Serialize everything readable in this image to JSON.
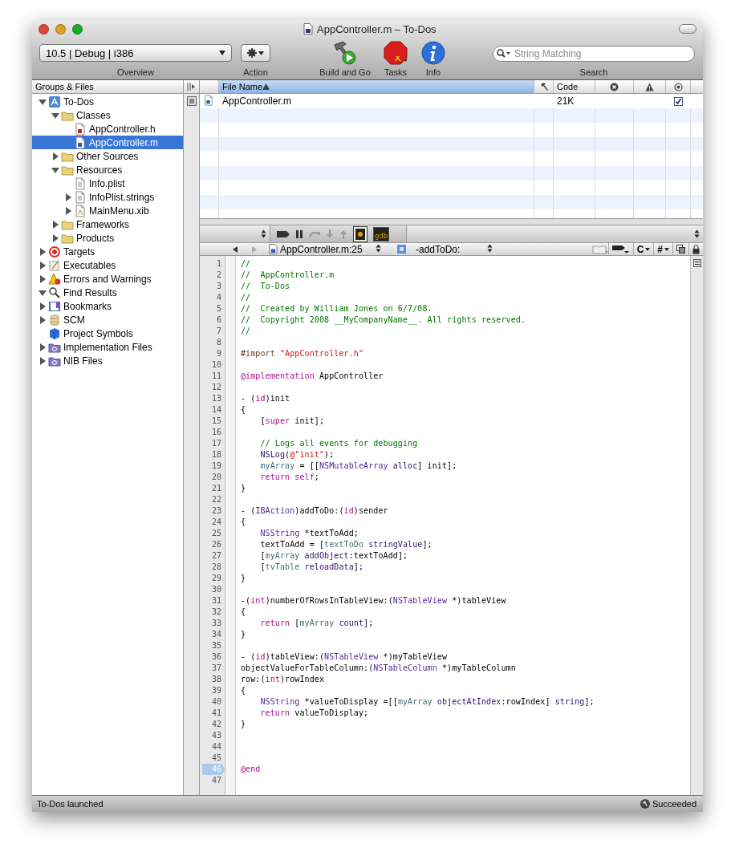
{
  "window": {
    "title": "AppController.m – To-Dos"
  },
  "toolbar": {
    "scheme": "10.5 | Debug | i386",
    "labels": [
      "Overview",
      "Action",
      "Build and Go",
      "Tasks",
      "Info",
      "Search"
    ],
    "search": {
      "placeholder": "String Matching"
    }
  },
  "sidebar": {
    "title": "Groups & Files",
    "items": [
      {
        "label": "To-Dos",
        "kind": "project",
        "expanded": true,
        "selected": false,
        "children": [
          {
            "label": "Classes",
            "kind": "folder",
            "expanded": true,
            "selected": false,
            "children": [
              {
                "label": "AppController.h",
                "kind": "header",
                "selected": false
              },
              {
                "label": "AppController.m",
                "kind": "source",
                "selected": true
              }
            ]
          },
          {
            "label": "Other Sources",
            "kind": "folder",
            "expanded": false,
            "selected": false
          },
          {
            "label": "Resources",
            "kind": "folder",
            "expanded": true,
            "selected": false,
            "children": [
              {
                "label": "Info.plist",
                "kind": "plist",
                "selected": false
              },
              {
                "label": "InfoPlist.strings",
                "kind": "plist",
                "expanded": false,
                "selected": false
              },
              {
                "label": "MainMenu.xib",
                "kind": "xib",
                "expanded": false,
                "selected": false
              }
            ]
          },
          {
            "label": "Frameworks",
            "kind": "folder",
            "expanded": false,
            "selected": false
          },
          {
            "label": "Products",
            "kind": "folder",
            "expanded": false,
            "selected": false
          }
        ]
      },
      {
        "label": "Targets",
        "kind": "target",
        "expanded": false,
        "selected": false
      },
      {
        "label": "Executables",
        "kind": "executable",
        "expanded": false,
        "selected": false
      },
      {
        "label": "Errors and Warnings",
        "kind": "warning",
        "expanded": false,
        "selected": false
      },
      {
        "label": "Find Results",
        "kind": "search",
        "expanded": true,
        "selected": false
      },
      {
        "label": "Bookmarks",
        "kind": "bookmark",
        "expanded": false,
        "selected": false
      },
      {
        "label": "SCM",
        "kind": "scm",
        "expanded": false,
        "selected": false
      },
      {
        "label": "Project Symbols",
        "kind": "symbols",
        "selected": false
      },
      {
        "label": "Implementation Files",
        "kind": "smart",
        "expanded": false,
        "selected": false
      },
      {
        "label": "NIB Files",
        "kind": "smart",
        "expanded": false,
        "selected": false
      }
    ]
  },
  "table": {
    "columns": [
      {
        "kind": "text",
        "label": "File Name",
        "selected": true
      },
      {
        "kind": "build"
      },
      {
        "kind": "text",
        "label": "Code",
        "selected": false
      },
      {
        "kind": "errors"
      },
      {
        "kind": "warnings"
      },
      {
        "kind": "target"
      }
    ],
    "rows": [
      {
        "file": "AppController.m",
        "code": "21K",
        "checked": true
      }
    ]
  },
  "debugger": {
    "console_label": "gdb"
  },
  "navigator": {
    "file": "AppController.m:25",
    "symbol": "-addToDo:",
    "menus": [
      "C",
      "#"
    ]
  },
  "editor": {
    "lines": [
      {
        "number": "1",
        "current": false,
        "segments": [
          {
            "kind": "comment",
            "text": "//"
          }
        ]
      },
      {
        "number": "2",
        "current": false,
        "segments": [
          {
            "kind": "comment",
            "text": "//  AppController.m"
          }
        ]
      },
      {
        "number": "3",
        "current": false,
        "segments": [
          {
            "kind": "comment",
            "text": "//  To-Dos"
          }
        ]
      },
      {
        "number": "4",
        "current": false,
        "segments": [
          {
            "kind": "comment",
            "text": "//"
          }
        ]
      },
      {
        "number": "5",
        "current": false,
        "segments": [
          {
            "kind": "comment",
            "text": "//  Created by William Jones on 6/7/08."
          }
        ]
      },
      {
        "number": "6",
        "current": false,
        "segments": [
          {
            "kind": "comment",
            "text": "//  Copyright 2008 __MyCompanyName__. All rights reserved."
          }
        ]
      },
      {
        "number": "7",
        "current": false,
        "segments": [
          {
            "kind": "comment",
            "text": "//"
          }
        ]
      },
      {
        "number": "8",
        "current": false
      },
      {
        "number": "9",
        "current": false,
        "segments": [
          {
            "kind": "preprocessor",
            "text": "#import "
          },
          {
            "kind": "string",
            "text": "\"AppController.h\""
          }
        ]
      },
      {
        "number": "10",
        "current": false
      },
      {
        "number": "11",
        "current": false,
        "segments": [
          {
            "kind": "keyword",
            "text": "@implementation"
          },
          {
            "kind": "plain",
            "text": " AppController"
          }
        ]
      },
      {
        "number": "12",
        "current": false
      },
      {
        "number": "13",
        "current": false,
        "segments": [
          {
            "kind": "plain",
            "text": "- ("
          },
          {
            "kind": "keyword",
            "text": "id"
          },
          {
            "kind": "plain",
            "text": ")init"
          }
        ]
      },
      {
        "number": "14",
        "current": false,
        "segments": [
          {
            "kind": "plain",
            "text": "{"
          }
        ]
      },
      {
        "number": "15",
        "current": false,
        "segments": [
          {
            "kind": "plain",
            "text": "    ["
          },
          {
            "kind": "keyword",
            "text": "super"
          },
          {
            "kind": "plain",
            "text": " init];"
          }
        ]
      },
      {
        "number": "16",
        "current": false
      },
      {
        "number": "17",
        "current": false,
        "segments": [
          {
            "kind": "comment",
            "text": "    // Logs all events for debugging"
          }
        ]
      },
      {
        "number": "18",
        "current": false,
        "segments": [
          {
            "kind": "method",
            "text": "    NSLog"
          },
          {
            "kind": "plain",
            "text": "("
          },
          {
            "kind": "string",
            "text": "@\"init\""
          },
          {
            "kind": "plain",
            "text": ");"
          }
        ]
      },
      {
        "number": "19",
        "current": false,
        "segments": [
          {
            "kind": "ivar",
            "text": "    myArray"
          },
          {
            "kind": "plain",
            "text": " = [["
          },
          {
            "kind": "class",
            "text": "NSMutableArray"
          },
          {
            "kind": "method",
            "text": " alloc"
          },
          {
            "kind": "plain",
            "text": "] init];"
          }
        ]
      },
      {
        "number": "20",
        "current": false,
        "segments": [
          {
            "kind": "keyword",
            "text": "    return self"
          },
          {
            "kind": "plain",
            "text": ";"
          }
        ]
      },
      {
        "number": "21",
        "current": false,
        "segments": [
          {
            "kind": "plain",
            "text": "}"
          }
        ]
      },
      {
        "number": "22",
        "current": false
      },
      {
        "number": "23",
        "current": false,
        "segments": [
          {
            "kind": "plain",
            "text": "- ("
          },
          {
            "kind": "class",
            "text": "IBAction"
          },
          {
            "kind": "plain",
            "text": ")addToDo:("
          },
          {
            "kind": "keyword",
            "text": "id"
          },
          {
            "kind": "plain",
            "text": ")sender"
          }
        ]
      },
      {
        "number": "24",
        "current": false,
        "segments": [
          {
            "kind": "plain",
            "text": "{"
          }
        ]
      },
      {
        "number": "25",
        "current": false,
        "segments": [
          {
            "kind": "class",
            "text": "    NSString"
          },
          {
            "kind": "plain",
            "text": " *textToAdd;"
          }
        ]
      },
      {
        "number": "26",
        "current": false,
        "segments": [
          {
            "kind": "plain",
            "text": "    textToAdd = ["
          },
          {
            "kind": "ivar",
            "text": "textToDo"
          },
          {
            "kind": "method",
            "text": " stringValue"
          },
          {
            "kind": "plain",
            "text": "];"
          }
        ]
      },
      {
        "number": "27",
        "current": false,
        "segments": [
          {
            "kind": "plain",
            "text": "    ["
          },
          {
            "kind": "ivar",
            "text": "myArray"
          },
          {
            "kind": "method",
            "text": " addObject"
          },
          {
            "kind": "plain",
            "text": ":textToAdd];"
          }
        ]
      },
      {
        "number": "28",
        "current": false,
        "segments": [
          {
            "kind": "plain",
            "text": "    ["
          },
          {
            "kind": "ivar",
            "text": "tvTable"
          },
          {
            "kind": "method",
            "text": " reloadData"
          },
          {
            "kind": "plain",
            "text": "];"
          }
        ]
      },
      {
        "number": "29",
        "current": false,
        "segments": [
          {
            "kind": "plain",
            "text": "}"
          }
        ]
      },
      {
        "number": "30",
        "current": false
      },
      {
        "number": "31",
        "current": false,
        "segments": [
          {
            "kind": "plain",
            "text": "-("
          },
          {
            "kind": "keyword",
            "text": "int"
          },
          {
            "kind": "plain",
            "text": ")numberOfRowsInTableView:("
          },
          {
            "kind": "class",
            "text": "NSTableView"
          },
          {
            "kind": "plain",
            "text": " *)tableView"
          }
        ]
      },
      {
        "number": "32",
        "current": false,
        "segments": [
          {
            "kind": "plain",
            "text": "{"
          }
        ]
      },
      {
        "number": "33",
        "current": false,
        "segments": [
          {
            "kind": "keyword",
            "text": "    return"
          },
          {
            "kind": "plain",
            "text": " ["
          },
          {
            "kind": "ivar",
            "text": "myArray"
          },
          {
            "kind": "method",
            "text": " count"
          },
          {
            "kind": "plain",
            "text": "];"
          }
        ]
      },
      {
        "number": "34",
        "current": false,
        "segments": [
          {
            "kind": "plain",
            "text": "}"
          }
        ]
      },
      {
        "number": "35",
        "current": false
      },
      {
        "number": "36",
        "current": false,
        "segments": [
          {
            "kind": "plain",
            "text": "- ("
          },
          {
            "kind": "keyword",
            "text": "id"
          },
          {
            "kind": "plain",
            "text": ")tableView:("
          },
          {
            "kind": "class",
            "text": "NSTableView"
          },
          {
            "kind": "plain",
            "text": " *)myTableView"
          }
        ]
      },
      {
        "number": "37",
        "current": false,
        "segments": [
          {
            "kind": "plain",
            "text": "objectValueForTableColumn:("
          },
          {
            "kind": "class",
            "text": "NSTableColumn"
          },
          {
            "kind": "plain",
            "text": " *)myTableColumn"
          }
        ]
      },
      {
        "number": "38",
        "current": false,
        "segments": [
          {
            "kind": "plain",
            "text": "row:("
          },
          {
            "kind": "keyword",
            "text": "int"
          },
          {
            "kind": "plain",
            "text": ")rowIndex"
          }
        ]
      },
      {
        "number": "39",
        "current": false,
        "segments": [
          {
            "kind": "plain",
            "text": "{"
          }
        ]
      },
      {
        "number": "40",
        "current": false,
        "segments": [
          {
            "kind": "class",
            "text": "    NSString"
          },
          {
            "kind": "plain",
            "text": " *valueToDisplay =[["
          },
          {
            "kind": "ivar",
            "text": "myArray"
          },
          {
            "kind": "method",
            "text": " objectAtIndex"
          },
          {
            "kind": "plain",
            "text": ":rowIndex] "
          },
          {
            "kind": "method",
            "text": "string"
          },
          {
            "kind": "plain",
            "text": "];"
          }
        ]
      },
      {
        "number": "41",
        "current": false,
        "segments": [
          {
            "kind": "keyword",
            "text": "    return"
          },
          {
            "kind": "plain",
            "text": " valueToDisplay;"
          }
        ]
      },
      {
        "number": "42",
        "current": false,
        "segments": [
          {
            "kind": "plain",
            "text": "}"
          }
        ]
      },
      {
        "number": "43",
        "current": false
      },
      {
        "number": "44",
        "current": false
      },
      {
        "number": "45",
        "current": false
      },
      {
        "number": "46",
        "current": true,
        "segments": [
          {
            "kind": "keyword",
            "text": "@end"
          }
        ]
      },
      {
        "number": "47",
        "current": false
      }
    ]
  },
  "status_bar": {
    "message": "To-Dos launched",
    "result": "Succeeded"
  }
}
